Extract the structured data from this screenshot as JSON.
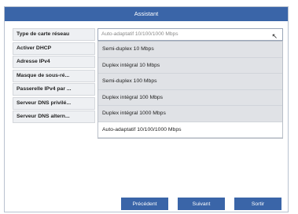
{
  "window": {
    "title": "Assistant"
  },
  "form": {
    "rows": [
      {
        "label": "Type de carte réseau",
        "value": "Auto-adaptatif 10/100/1000 Mbps"
      },
      {
        "label": "Activer DHCP"
      },
      {
        "label": "Adresse IPv4"
      },
      {
        "label": "Masque de sous-ré..."
      },
      {
        "label": "Passerelle IPv4 par ..."
      },
      {
        "label": "Serveur DNS privilé..."
      },
      {
        "label": "Serveur DNS altern..."
      }
    ]
  },
  "dropdown": {
    "options": [
      "Semi-duplex 10 Mbps",
      "Duplex intégral 10 Mbps",
      "Semi-duplex 100 Mbps",
      "Duplex intégral 100 Mbps",
      "Duplex intégral 1000 Mbps",
      "Auto-adaptatif 10/100/1000 Mbps"
    ],
    "selected_index": 5
  },
  "buttons": {
    "previous": "Précédent",
    "next": "Suivant",
    "exit": "Sortir"
  },
  "colors": {
    "accent": "#3a65a8"
  }
}
